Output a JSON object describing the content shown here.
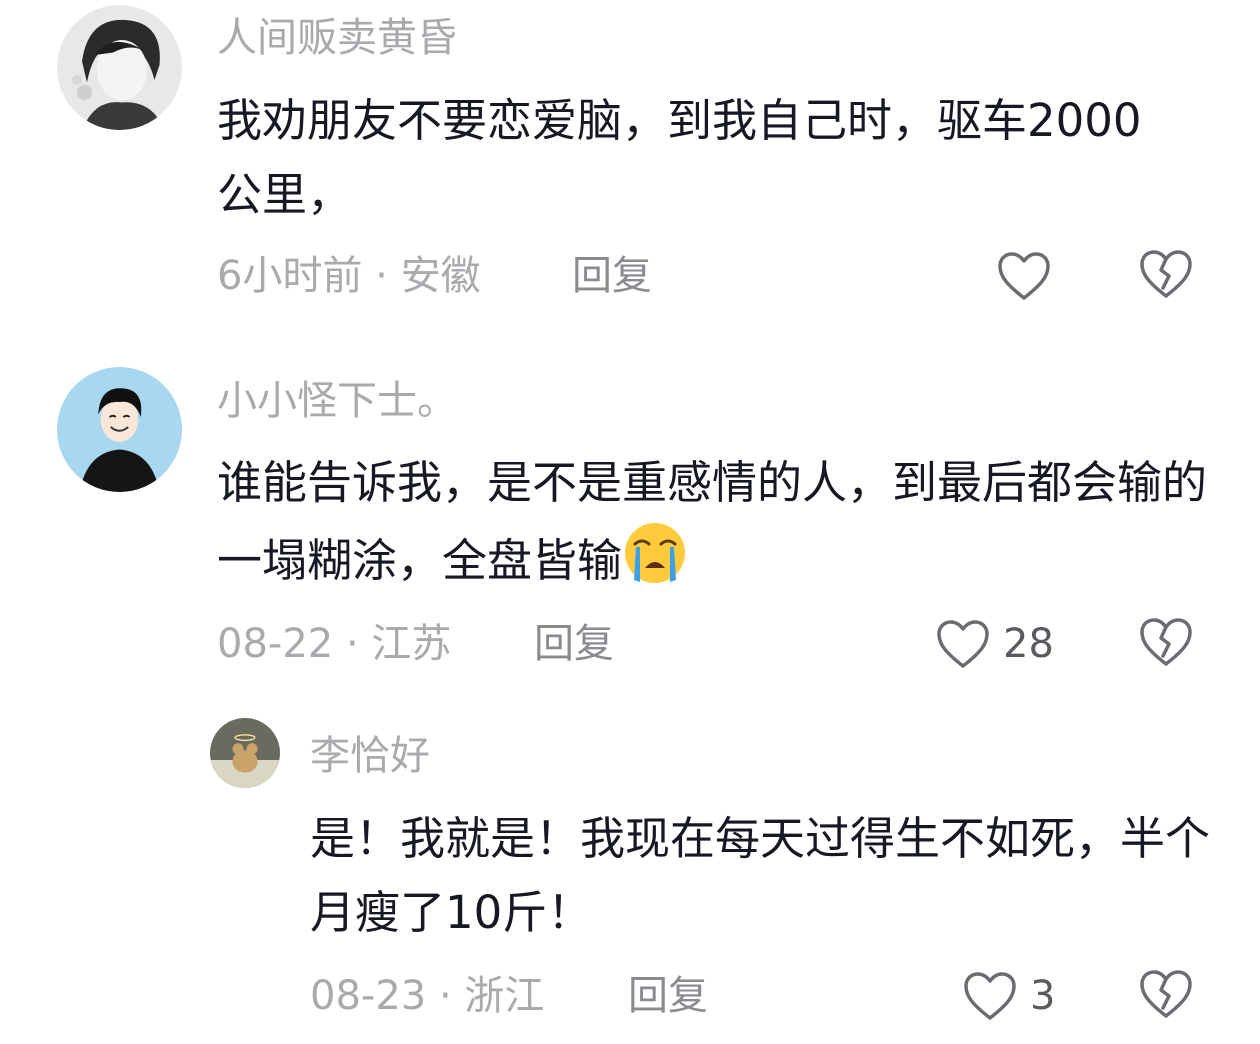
{
  "comments": [
    {
      "username": "人间贩卖黄昏",
      "text": "我劝朋友不要恋爱脑，到我自己时，驱车2000公里，",
      "time": "6小时前",
      "location": "安徽",
      "reply_label": "回复",
      "likes": "",
      "avatar_icon": "boy-anime-avatar-icon"
    },
    {
      "username": "小小怪下士。",
      "text": "谁能告诉我，是不是重感情的人，到最后都会输的一塌糊涂，全盘皆输",
      "emoji": "loudly-crying-face-emoji",
      "time": "08-22",
      "location": "江苏",
      "reply_label": "回复",
      "likes": "28",
      "avatar_icon": "smiling-boy-avatar-icon"
    },
    {
      "username": "李恰好",
      "text": "是！我就是！我现在每天过得生不如死，半个月瘦了10斤！",
      "time": "08-23",
      "location": "浙江",
      "reply_label": "回复",
      "likes": "3",
      "avatar_icon": "teddy-bear-avatar-icon"
    }
  ],
  "colors": {
    "text": "#161823",
    "meta": "#a9a9ae",
    "reply": "#8a8b91",
    "icon": "#6b6c72",
    "background": "#ffffff"
  }
}
